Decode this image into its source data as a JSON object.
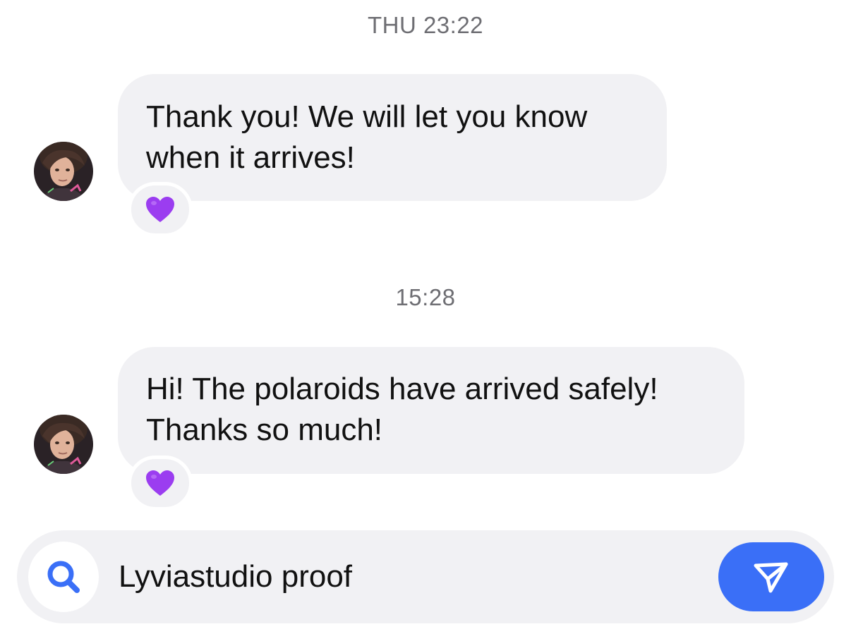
{
  "conversation": {
    "sections": [
      {
        "timestamp": "THU 23:22",
        "message": {
          "line1": "Thank you! We will let you know",
          "line2": "when it arrives!",
          "reaction": "💜"
        }
      },
      {
        "timestamp": "15:28",
        "message": {
          "line1": "Hi! The polaroids have arrived safely!",
          "line2": "Thanks so much!",
          "reaction": "💜"
        }
      }
    ]
  },
  "composer": {
    "value": "Lyviastudio proof",
    "search_icon": "search-icon",
    "send_icon": "send-icon"
  },
  "colors": {
    "accent": "#3a6ff7",
    "bubble": "#f1f1f4",
    "reaction_heart": "#9b3df0",
    "timestamp": "#6e6e73"
  }
}
